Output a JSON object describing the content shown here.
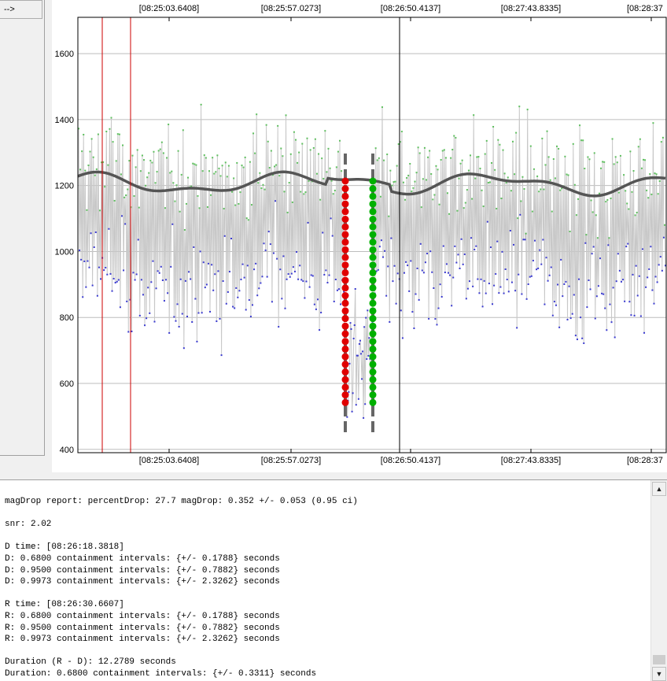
{
  "nav_button": {
    "label": "-->"
  },
  "chart_data": {
    "type": "scatter",
    "time_ticks": [
      "[08:25:03.6408]",
      "[08:25:57.0273]",
      "[08:26:50.4137]",
      "[08:27:43.8335]",
      "[08:28:37"
    ],
    "y_ticks": [
      400,
      600,
      800,
      1000,
      1200,
      1400,
      1600
    ],
    "ylim": [
      390,
      1710
    ],
    "grid": true,
    "series": [
      {
        "kind": "raw",
        "color": "#c8c8c8"
      },
      {
        "kind": "upper-points",
        "color": "#5fbf5f"
      },
      {
        "kind": "lower-points",
        "color": "#3a3acf"
      },
      {
        "kind": "smoothed",
        "color": "#555555"
      }
    ],
    "d_marker_color": "#e00000",
    "r_marker_color": "#00b000",
    "cursor_line_color": "#cc0000"
  },
  "report": {
    "lines": [
      "magDrop report: percentDrop: 27.7 magDrop: 0.352 +/- 0.053 (0.95 ci)",
      "",
      "snr: 2.02",
      "",
      "D time: [08:26:18.3818]",
      "D: 0.6800 containment intervals: {+/- 0.1788} seconds",
      "D: 0.9500 containment intervals: {+/- 0.7882} seconds",
      "D: 0.9973 containment intervals: {+/- 2.3262} seconds",
      "",
      "R time: [08:26:30.6607]",
      "R: 0.6800 containment intervals: {+/- 0.1788} seconds",
      "R: 0.9500 containment intervals: {+/- 0.7882} seconds",
      "R: 0.9973 containment intervals: {+/- 2.3262} seconds",
      "",
      "Duration (R - D): 12.2789 seconds",
      "Duration: 0.6800 containment intervals: {+/- 0.3311} seconds"
    ]
  },
  "scrollbar": {
    "up_icon": "▲",
    "down_icon": "▼"
  }
}
